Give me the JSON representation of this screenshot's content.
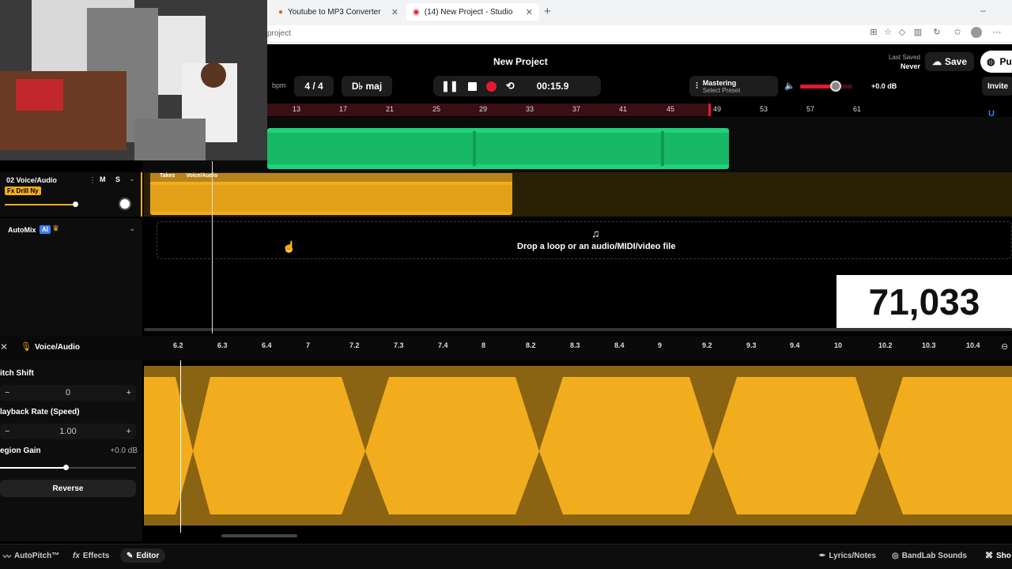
{
  "browser": {
    "tabs": [
      {
        "label": "Youtube to MP3 Converter"
      },
      {
        "label": "(14) New Project - Studio"
      }
    ],
    "new_tab": "+",
    "url": "project",
    "window_minimize": "–"
  },
  "header": {
    "title": "New Project",
    "last_saved_label": "Last Saved",
    "last_saved_value": "Never",
    "save_label": "Save",
    "publish_label": "Pu",
    "invite_label": "Invite"
  },
  "transport": {
    "bpm_label": "bpm",
    "time_signature": "4 / 4",
    "key": "D♭ maj",
    "time": "00:15.9"
  },
  "mastering": {
    "label": "Mastering",
    "sub": "Select Preset"
  },
  "volume": {
    "db": "+0.0 dB",
    "level": 0.7
  },
  "ruler": {
    "ticks": [
      "13",
      "17",
      "21",
      "25",
      "29",
      "33",
      "37",
      "41",
      "45",
      "49",
      "53",
      "57",
      "61"
    ]
  },
  "tracks": [
    {
      "name": "02 Voice/Audio",
      "fx": "Fx Drill Ny",
      "mute": "M",
      "solo": "S",
      "region_label": "Takes",
      "region_name": "Voice/Audio"
    }
  ],
  "automix": {
    "label": "AutoMix",
    "badge": "AI"
  },
  "drop_zone": {
    "text": "Drop a loop or an audio/MIDI/video file"
  },
  "counter": {
    "value": "71,033"
  },
  "editor": {
    "title": "Voice/Audio",
    "ticks": [
      "6.2",
      "6.3",
      "6.4",
      "7",
      "7.2",
      "7.3",
      "7.4",
      "8",
      "8.2",
      "8.3",
      "8.4",
      "9",
      "9.2",
      "9.3",
      "9.4",
      "10",
      "10.2",
      "10.3",
      "10.4"
    ],
    "pitch_shift_label": "itch Shift",
    "pitch_shift_value": "0",
    "playback_rate_label": "layback Rate (Speed)",
    "playback_rate_value": "1.00",
    "region_gain_label": "egion Gain",
    "region_gain_value": "+0.0 dB",
    "reverse_label": "Reverse"
  },
  "bottom": {
    "autopitch": "AutoPitch™",
    "effects": "Effects",
    "editor": "Editor",
    "lyrics": "Lyrics/Notes",
    "sounds": "BandLab Sounds",
    "shortcuts": "Sho"
  },
  "colors": {
    "accent_green": "#1fd17a",
    "accent_yellow": "#f2ad1e",
    "record_red": "#e3192d"
  }
}
